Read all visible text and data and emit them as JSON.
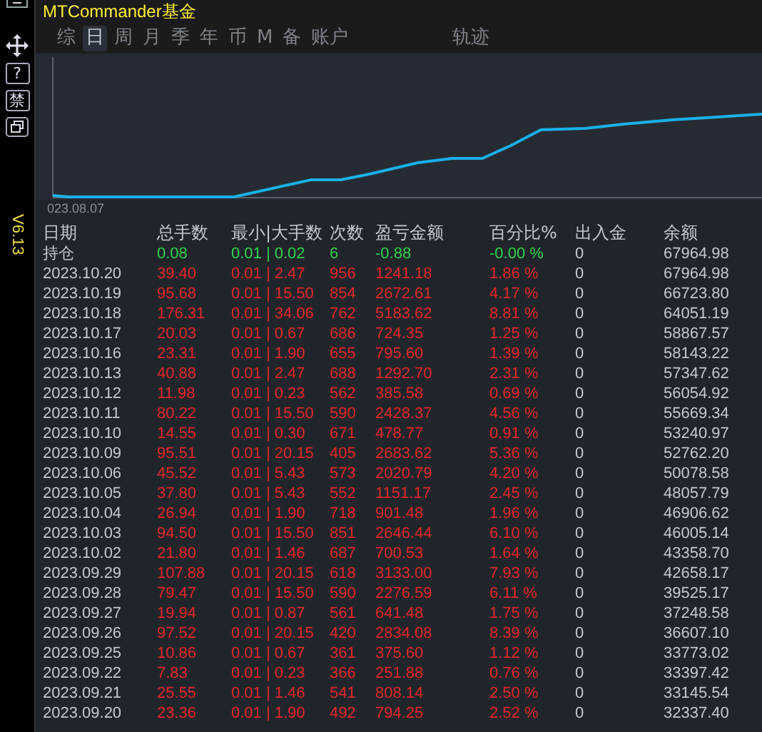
{
  "window": {
    "title": "MTCommander基金"
  },
  "side_toolbar": {
    "forbid_button": "禁",
    "help_button": "?",
    "version": "V6.13"
  },
  "tabs": [
    {
      "label": "综",
      "selected": false
    },
    {
      "label": "日",
      "selected": true
    },
    {
      "label": "周",
      "selected": false
    },
    {
      "label": "月",
      "selected": false
    },
    {
      "label": "季",
      "selected": false
    },
    {
      "label": "年",
      "selected": false
    },
    {
      "label": "币",
      "selected": false
    },
    {
      "label": "M",
      "selected": false
    },
    {
      "label": "备",
      "selected": false
    },
    {
      "label": "账户",
      "selected": false
    },
    {
      "label": "轨迹",
      "selected": false
    }
  ],
  "chart": {
    "start_label": "023.08.07"
  },
  "table": {
    "columns": [
      "日期",
      "总手数",
      "最小|大手数",
      "次数",
      "盈亏金额",
      "百分比%",
      "出入金",
      "余额"
    ],
    "rows": [
      {
        "kind": "position",
        "cells": [
          "持仓",
          "0.08",
          "0.01 | 0.02",
          "6",
          "-0.88",
          "-0.00 %",
          "0",
          "67964.98"
        ]
      },
      {
        "kind": "day",
        "cells": [
          "2023.10.20",
          "39.40",
          "0.01 | 2.47",
          "956",
          "1241.18",
          "1.86 %",
          "0",
          "67964.98"
        ]
      },
      {
        "kind": "day",
        "cells": [
          "2023.10.19",
          "95.68",
          "0.01 | 15.50",
          "854",
          "2672.61",
          "4.17 %",
          "0",
          "66723.80"
        ]
      },
      {
        "kind": "day",
        "cells": [
          "2023.10.18",
          "176.31",
          "0.01 | 34.06",
          "762",
          "5183.62",
          "8.81 %",
          "0",
          "64051.19"
        ]
      },
      {
        "kind": "day",
        "cells": [
          "2023.10.17",
          "20.03",
          "0.01 | 0.67",
          "686",
          "724.35",
          "1.25 %",
          "0",
          "58867.57"
        ]
      },
      {
        "kind": "day",
        "cells": [
          "2023.10.16",
          "23.31",
          "0.01 | 1.90",
          "655",
          "795.60",
          "1.39 %",
          "0",
          "58143.22"
        ]
      },
      {
        "kind": "day",
        "cells": [
          "2023.10.13",
          "40.88",
          "0.01 | 2.47",
          "688",
          "1292.70",
          "2.31 %",
          "0",
          "57347.62"
        ]
      },
      {
        "kind": "day",
        "cells": [
          "2023.10.12",
          "11.98",
          "0.01 | 0.23",
          "562",
          "385.58",
          "0.69 %",
          "0",
          "56054.92"
        ]
      },
      {
        "kind": "day",
        "cells": [
          "2023.10.11",
          "80.22",
          "0.01 | 15.50",
          "590",
          "2428.37",
          "4.56 %",
          "0",
          "55669.34"
        ]
      },
      {
        "kind": "day",
        "cells": [
          "2023.10.10",
          "14.55",
          "0.01 | 0.30",
          "671",
          "478.77",
          "0.91 %",
          "0",
          "53240.97"
        ]
      },
      {
        "kind": "day",
        "cells": [
          "2023.10.09",
          "95.51",
          "0.01 | 20.15",
          "405",
          "2683.62",
          "5.36 %",
          "0",
          "52762.20"
        ]
      },
      {
        "kind": "day",
        "cells": [
          "2023.10.06",
          "45.52",
          "0.01 | 5.43",
          "573",
          "2020.79",
          "4.20 %",
          "0",
          "50078.58"
        ]
      },
      {
        "kind": "day",
        "cells": [
          "2023.10.05",
          "37.80",
          "0.01 | 5.43",
          "552",
          "1151.17",
          "2.45 %",
          "0",
          "48057.79"
        ]
      },
      {
        "kind": "day",
        "cells": [
          "2023.10.04",
          "26.94",
          "0.01 | 1.90",
          "718",
          "901.48",
          "1.96 %",
          "0",
          "46906.62"
        ]
      },
      {
        "kind": "day",
        "cells": [
          "2023.10.03",
          "94.50",
          "0.01 | 15.50",
          "851",
          "2646.44",
          "6.10 %",
          "0",
          "46005.14"
        ]
      },
      {
        "kind": "day",
        "cells": [
          "2023.10.02",
          "21.80",
          "0.01 | 1.46",
          "687",
          "700.53",
          "1.64 %",
          "0",
          "43358.70"
        ]
      },
      {
        "kind": "day",
        "cells": [
          "2023.09.29",
          "107.88",
          "0.01 | 20.15",
          "618",
          "3133.00",
          "7.93 %",
          "0",
          "42658.17"
        ]
      },
      {
        "kind": "day",
        "cells": [
          "2023.09.28",
          "79.47",
          "0.01 | 15.50",
          "590",
          "2276.59",
          "6.11 %",
          "0",
          "39525.17"
        ]
      },
      {
        "kind": "day",
        "cells": [
          "2023.09.27",
          "19.94",
          "0.01 | 0.87",
          "561",
          "641.48",
          "1.75 %",
          "0",
          "37248.58"
        ]
      },
      {
        "kind": "day",
        "cells": [
          "2023.09.26",
          "97.52",
          "0.01 | 20.15",
          "420",
          "2834.08",
          "8.39 %",
          "0",
          "36607.10"
        ]
      },
      {
        "kind": "day",
        "cells": [
          "2023.09.25",
          "10.86",
          "0.01 | 0.67",
          "361",
          "375.60",
          "1.12 %",
          "0",
          "33773.02"
        ]
      },
      {
        "kind": "day",
        "cells": [
          "2023.09.22",
          "7.83",
          "0.01 | 0.23",
          "366",
          "251.88",
          "0.76 %",
          "0",
          "33397.42"
        ]
      },
      {
        "kind": "day",
        "cells": [
          "2023.09.21",
          "25.55",
          "0.01 | 1.46",
          "541",
          "808.14",
          "2.50 %",
          "0",
          "33145.54"
        ]
      },
      {
        "kind": "day",
        "cells": [
          "2023.09.20",
          "23.36",
          "0.01 | 1.90",
          "492",
          "794.25",
          "2.52 %",
          "0",
          "32337.40"
        ]
      }
    ]
  }
}
